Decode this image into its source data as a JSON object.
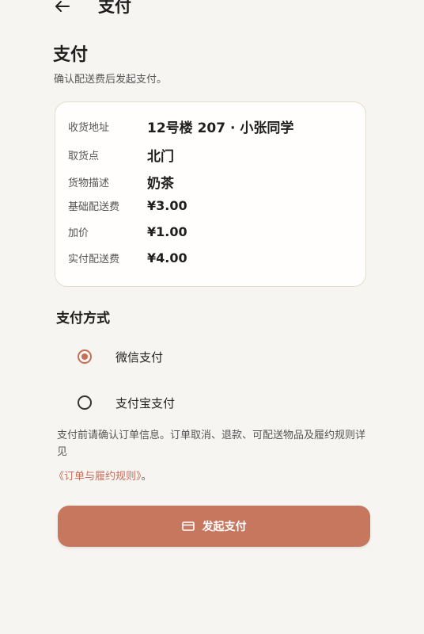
{
  "header": {
    "back_icon": "arrow-left-icon",
    "title": "支付"
  },
  "section": {
    "title": "支付",
    "subtitle": "确认配送费后发起支付。"
  },
  "order": {
    "rows": [
      {
        "label": "收货地址",
        "value": "12号楼 207 · 小张同学"
      },
      {
        "label": "取货点",
        "value": "北门"
      },
      {
        "label": "货物描述",
        "value": "奶茶"
      },
      {
        "label": "基础配送费",
        "value": "¥3.00"
      },
      {
        "label": "加价",
        "value": "¥1.00"
      },
      {
        "label": "实付配送费",
        "value": "¥4.00"
      }
    ]
  },
  "payment": {
    "title": "支付方式",
    "options": [
      {
        "label": "微信支付",
        "selected": true
      },
      {
        "label": "支付宝支付",
        "selected": false
      }
    ]
  },
  "notice": {
    "text": "支付前请确认订单信息。订单取消、退款、可配送物品及履约规则详见",
    "link": "《订单与履约规则》",
    "suffix": "。"
  },
  "submit": {
    "icon": "card-icon",
    "label": "发起支付"
  },
  "colors": {
    "accent": "#c8775f",
    "background": "#f7f5f1",
    "card": "#fffefc"
  }
}
